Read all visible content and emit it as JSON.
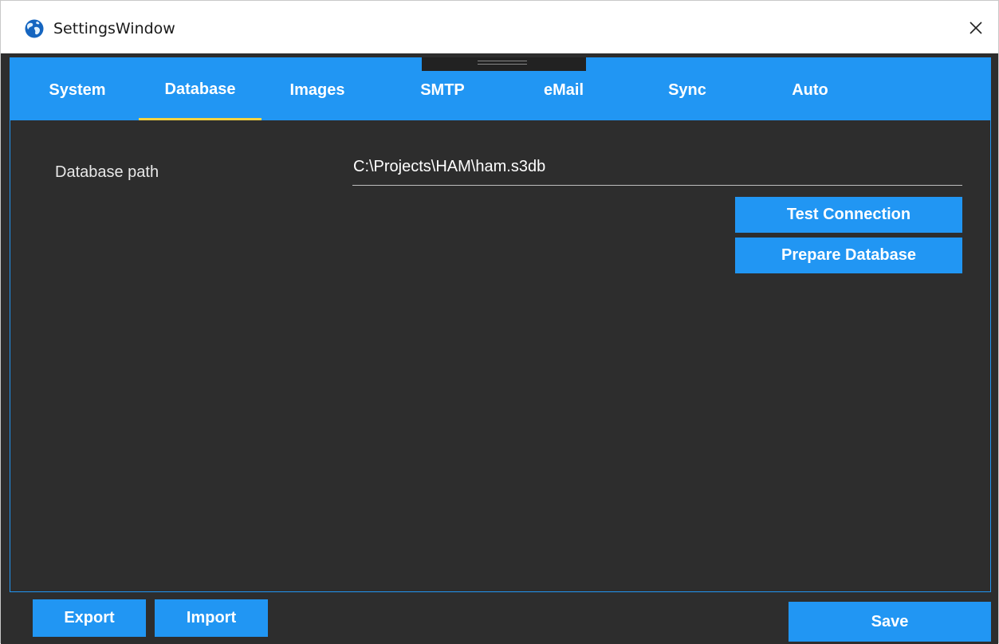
{
  "window": {
    "title": "SettingsWindow"
  },
  "tabs": [
    {
      "label": "System",
      "active": false
    },
    {
      "label": "Database",
      "active": true
    },
    {
      "label": "Images",
      "active": false
    },
    {
      "label": "SMTP",
      "active": false
    },
    {
      "label": "eMail",
      "active": false
    },
    {
      "label": "Sync",
      "active": false
    },
    {
      "label": "Auto",
      "active": false
    }
  ],
  "database": {
    "path_label": "Database path",
    "path_value": "C:\\Projects\\HAM\\ham.s3db",
    "test_connection_label": "Test Connection",
    "prepare_database_label": "Prepare Database"
  },
  "footer": {
    "export_label": "Export",
    "import_label": "Import",
    "save_label": "Save"
  },
  "colors": {
    "accent": "#2196f3",
    "background": "#2d2d2d",
    "active_tab_underline": "#f5d33f"
  },
  "icons": {
    "app": "globe-icon",
    "close": "close-icon"
  }
}
